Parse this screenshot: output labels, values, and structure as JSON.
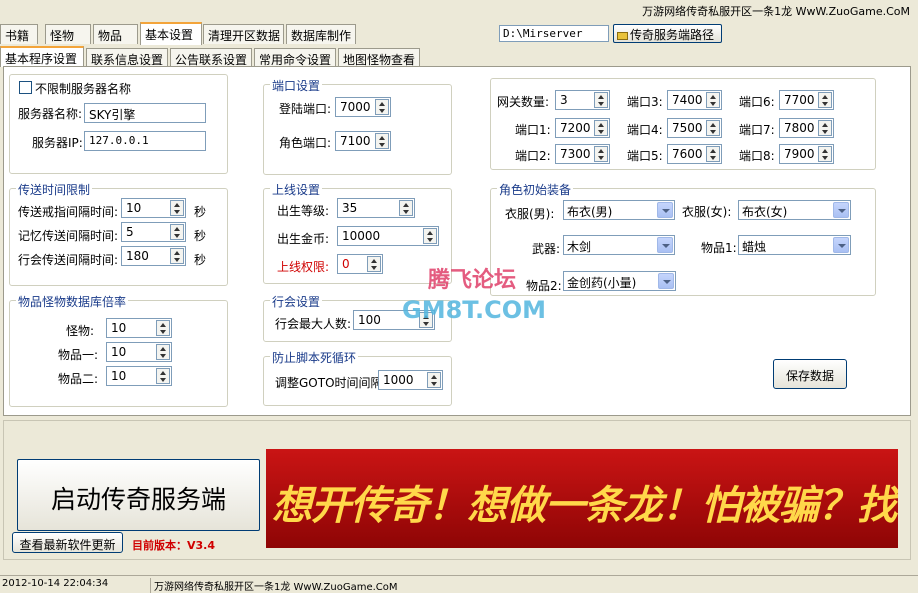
{
  "title": "万游网络传奇私服开区一条1龙 WwW.ZuoGame.CoM",
  "top_tabs": [
    "书籍",
    "怪物",
    "物品",
    "基本设置",
    "清理开区数据",
    "数据库制作"
  ],
  "path": {
    "value": "D:\\Mirserver",
    "button": "传奇服务端路径"
  },
  "sub_tabs": [
    "基本程序设置",
    "联系信息设置",
    "公告联系设置",
    "常用命令设置",
    "地图怪物查看"
  ],
  "server": {
    "no_limit": "不限制服务器名称",
    "name_label": "服务器名称:",
    "name_value": "SKY引擎",
    "ip_label": "服务器IP:",
    "ip_value": "127.0.0.1"
  },
  "ports": {
    "title": "端口设置",
    "login_label": "登陆端口:",
    "login_value": "7000",
    "role_label": "角色端口:",
    "role_value": "7100"
  },
  "gateway": {
    "count_label": "网关数量:",
    "count_value": "3",
    "p1": "端口1:",
    "v1": "7200",
    "p2": "端口2:",
    "v2": "7300",
    "p3": "端口3:",
    "v3": "7400",
    "p4": "端口4:",
    "v4": "7500",
    "p5": "端口5:",
    "v5": "7600",
    "p6": "端口6:",
    "v6": "7700",
    "p7": "端口7:",
    "v7": "7800",
    "p8": "端口8:",
    "v8": "7900"
  },
  "teleport": {
    "title": "传送时间限制",
    "unit": "秒",
    "ring_label": "传送戒指间隔时间:",
    "ring_value": "10",
    "memory_label": "记忆传送间隔时间:",
    "memory_value": "5",
    "guild_label": "行会传送间隔时间:",
    "guild_value": "180"
  },
  "online": {
    "title": "上线设置",
    "level_label": "出生等级:",
    "level_value": "35",
    "gold_label": "出生金币:",
    "gold_value": "10000",
    "perm_label": "上线权限:",
    "perm_value": "0"
  },
  "equip": {
    "title": "角色初始装备",
    "cloth_m_label": "衣服(男):",
    "cloth_m_value": "布衣(男)",
    "cloth_f_label": "衣服(女):",
    "cloth_f_value": "布衣(女)",
    "weapon_label": "武器:",
    "weapon_value": "木剑",
    "item1_label": "物品1:",
    "item1_value": "蜡烛",
    "item2_label": "物品2:",
    "item2_value": "金创药(小量)"
  },
  "rate": {
    "title": "物品怪物数据库倍率",
    "monster_label": "怪物:",
    "monster_value": "10",
    "item1_label": "物品一:",
    "item1_value": "10",
    "item2_label": "物品二:",
    "item2_value": "10"
  },
  "guild": {
    "title": "行会设置",
    "max_label": "行会最大人数:",
    "max_value": "100"
  },
  "script": {
    "title": "防止脚本死循环",
    "goto_label": "调整GOTO时间间隔:",
    "goto_value": "1000"
  },
  "save_button": "保存数据",
  "watermark": {
    "line1": "腾飞论坛",
    "line2": "GM8T.COM"
  },
  "start_button": "启动传奇服务端",
  "update_button": "查看最新软件更新",
  "version": "目前版本：V3.4",
  "banner": "想开传奇！想做一条龙！怕被骗？找信誉商万游网络",
  "status": {
    "datetime": "2012-10-14 22:04:34",
    "text": "万游网络传奇私服开区一条1龙 WwW.ZuoGame.CoM"
  },
  "colors": {
    "accent_tab": "#f3a43a",
    "group_title": "#1a3b8a",
    "warning_label": "#d00000",
    "banner_bg": "#ca1414",
    "banner_text": "#ffd84a"
  }
}
